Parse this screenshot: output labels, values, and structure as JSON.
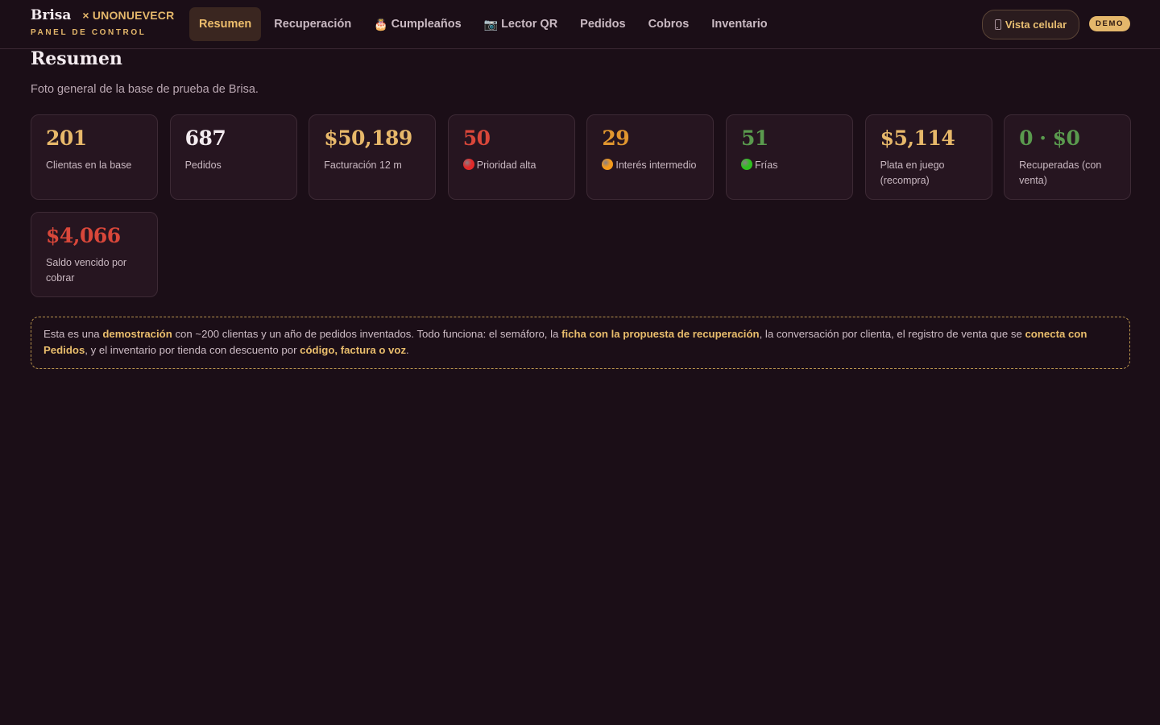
{
  "brand": {
    "name": "Brisa",
    "partner": "× UNONUEVECR",
    "subtitle": "PANEL DE CONTROL"
  },
  "nav": {
    "items": [
      {
        "label": "Resumen",
        "icon": "",
        "active": true
      },
      {
        "label": "Recuperación",
        "icon": "",
        "active": false
      },
      {
        "label": "Cumpleaños",
        "icon": "🎂",
        "active": false
      },
      {
        "label": "Lector QR",
        "icon": "📷",
        "active": false
      },
      {
        "label": "Pedidos",
        "icon": "",
        "active": false
      },
      {
        "label": "Cobros",
        "icon": "",
        "active": false
      },
      {
        "label": "Inventario",
        "icon": "",
        "active": false
      }
    ]
  },
  "header_actions": {
    "mobile_view_label": "Vista celular",
    "mobile_view_icon": "phone-icon",
    "demo_badge": "DEMO"
  },
  "page": {
    "title": "Resumen",
    "subtitle": "Foto general de la base de prueba de Brisa."
  },
  "stats": [
    {
      "value": "201",
      "label": "Clientas en la base",
      "color": "#e7b86a",
      "dot": null
    },
    {
      "value": "687",
      "label": "Pedidos",
      "color": "#f3ebef",
      "dot": null
    },
    {
      "value": "$50,189",
      "label": "Facturación 12 m",
      "color": "#e7b86a",
      "dot": null
    },
    {
      "value": "50",
      "label": "Prioridad alta",
      "color": "#d9473a",
      "dot": "#e02a2a"
    },
    {
      "value": "29",
      "label": "Interés intermedio",
      "color": "#e0962f",
      "dot": "#f39a1d"
    },
    {
      "value": "51",
      "label": "Frías",
      "color": "#5a9a4e",
      "dot": "#2fbf1f"
    },
    {
      "value": "$5,114",
      "label": "Plata en juego (recompra)",
      "color": "#e7b86a",
      "dot": null
    },
    {
      "value": "0 · $0",
      "label": "Recuperadas (con venta)",
      "color": "#5a9a4e",
      "dot": null
    },
    {
      "value": "$4,066",
      "label": "Saldo vencido por cobrar",
      "color": "#d9473a",
      "dot": null
    }
  ],
  "note": {
    "t1": "Esta es una ",
    "b1": "demostración",
    "t2": " con ~200 clientas y un año de pedidos inventados. Todo funciona: el semáforo, la ",
    "b2": "ficha con la propuesta de recuperación",
    "t3": ", la conversación por clienta, el registro de venta que se ",
    "b3": "conecta con Pedidos",
    "t4": ", y el inventario por tienda con descuento por ",
    "b4": "código, factura o voz",
    "t5": "."
  },
  "colors": {
    "background": "#1b0e17",
    "card": "#261520",
    "accent": "#e7b86a",
    "danger": "#d9473a",
    "warning": "#e0962f",
    "success": "#5a9a4e"
  }
}
